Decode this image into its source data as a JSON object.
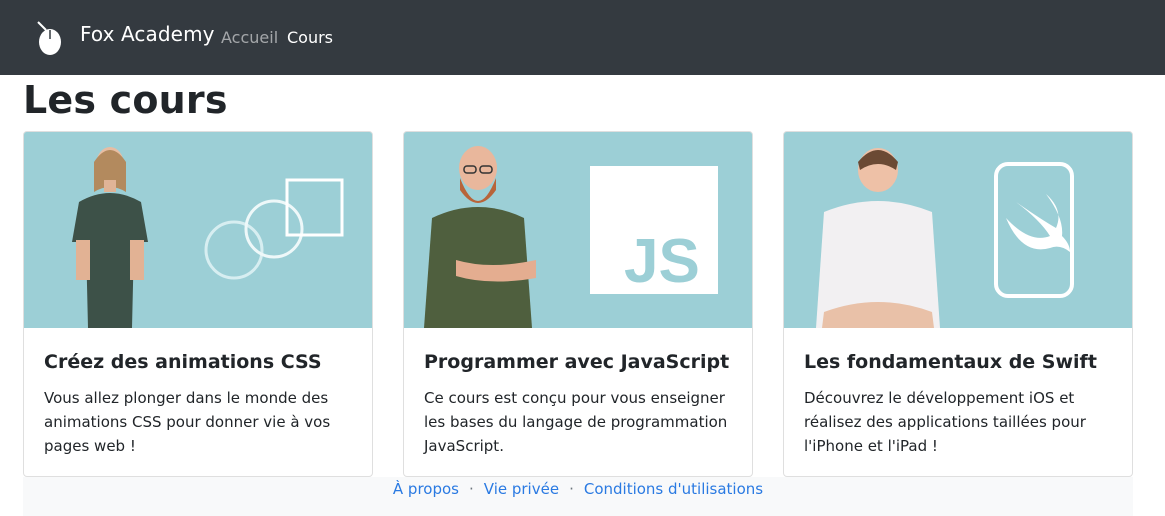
{
  "navbar": {
    "brand": "Fox Academy",
    "links": [
      {
        "label": "Accueil"
      },
      {
        "label": "Cours"
      }
    ]
  },
  "main": {
    "title": "Les cours",
    "cards": [
      {
        "title": "Créez des animations CSS",
        "text": "Vous allez plonger dans le monde des animations CSS pour donner vie à vos pages web !"
      },
      {
        "title": "Programmer avec JavaScript",
        "text": "Ce cours est conçu pour vous enseigner les bases du langage de programmation JavaScript.",
        "logo": "JS"
      },
      {
        "title": "Les fondamentaux de Swift",
        "text": "Découvrez le développement iOS et réalisez des applications taillées pour l'iPhone et l'iPad !"
      }
    ]
  },
  "footer": {
    "links": [
      {
        "label": "À propos"
      },
      {
        "label": "Vie privée"
      },
      {
        "label": "Conditions d'utilisations"
      }
    ],
    "separator": "·"
  },
  "colors": {
    "navbar_bg": "#343a40",
    "card_image_bg": "#9ccfd6",
    "link": "#2a7ae2",
    "footer_bg": "#f8f9fa"
  }
}
